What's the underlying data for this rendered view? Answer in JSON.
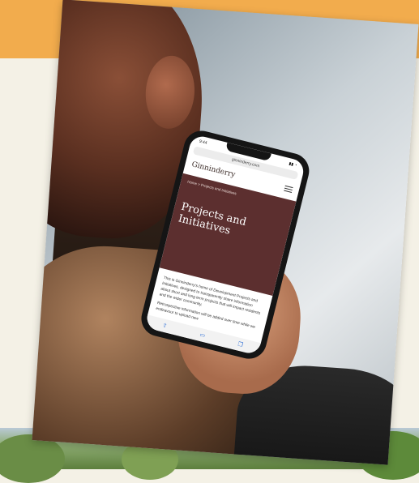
{
  "phone": {
    "time": "9:44",
    "url": "ginninderry.com",
    "site_logo": "Ginninderry",
    "breadcrumb": "Home  >  Projects and Initiatives",
    "page_title": "Projects and Initiatives",
    "body_text_1": "This is Ginninderry's home of Development Projects and Initiatives, designed to transparently share information about short and long term projects that will impact residents and the wider community.",
    "body_text_2": "Retrospective information will be added over time while we endeavour to upload new"
  },
  "colors": {
    "top_band": "#f2ac4d",
    "background": "#f4f1e6",
    "hero": "#5c2f2f"
  },
  "icons": [
    "menu-icon",
    "share-icon",
    "book-icon",
    "tabs-icon"
  ]
}
